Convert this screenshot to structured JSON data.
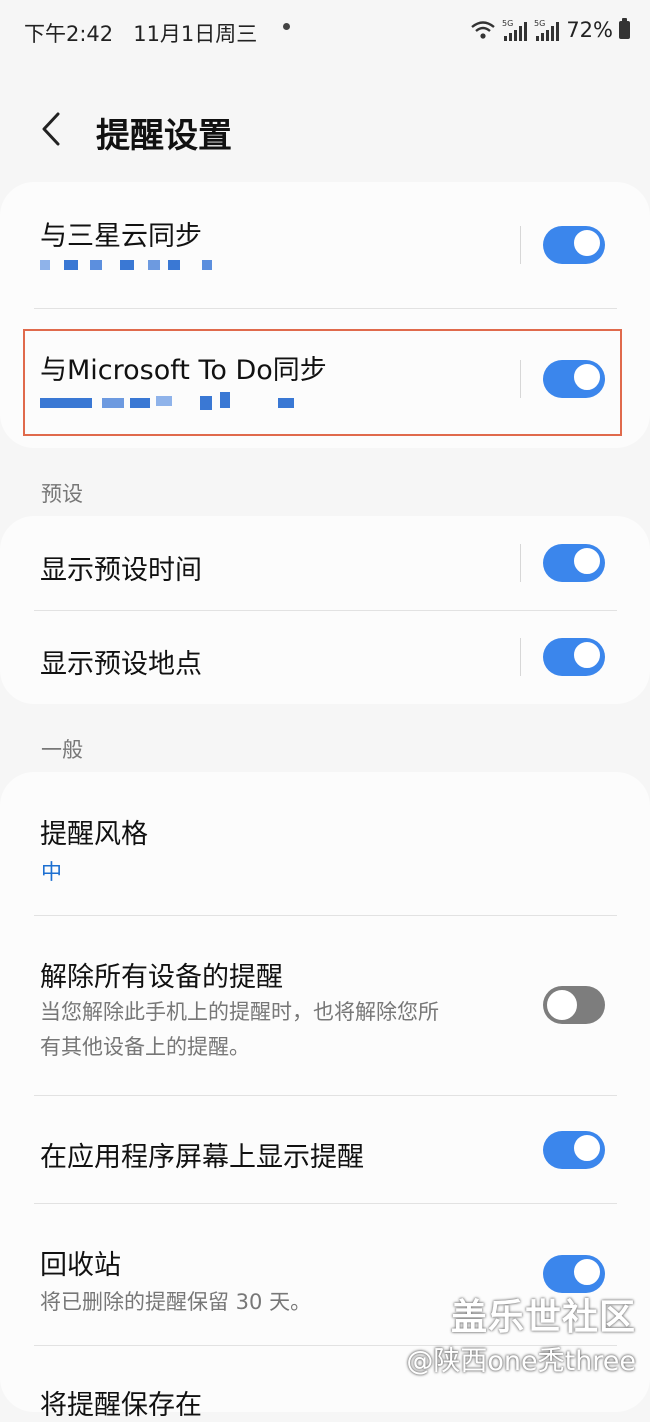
{
  "status_bar": {
    "time": "下午2:42",
    "date": "11月1日周三",
    "battery": "72%",
    "signal_label": "5G"
  },
  "header": {
    "title": "提醒设置"
  },
  "sync_section": {
    "samsung_cloud": {
      "label": "与三星云同步",
      "enabled": true
    },
    "microsoft_todo": {
      "label": "与Microsoft To Do同步",
      "enabled": true
    }
  },
  "presets_section": {
    "title": "预设",
    "show_preset_time": {
      "label": "显示预设时间",
      "enabled": true
    },
    "show_preset_location": {
      "label": "显示预设地点",
      "enabled": true
    }
  },
  "general_section": {
    "title": "一般",
    "reminder_style": {
      "label": "提醒风格",
      "value": "中"
    },
    "dismiss_all_devices": {
      "label": "解除所有设备的提醒",
      "description_line1": "当您解除此手机上的提醒时，也将解除您所",
      "description_line2": "有其他设备上的提醒。",
      "enabled": false
    },
    "show_on_app_screen": {
      "label": "在应用程序屏幕上显示提醒",
      "enabled": true
    },
    "recycle_bin": {
      "label": "回收站",
      "description": "将已删除的提醒保留 30 天。",
      "enabled": true
    },
    "next_item_partial": "将提醒保存在"
  },
  "watermark": {
    "line1": "盖乐世社区",
    "line2": "@陕西one秃three"
  },
  "colors": {
    "accent": "#3b86ec",
    "highlight_border": "#e06a4c",
    "background": "#f6f6f6",
    "card": "#fcfcfc"
  }
}
